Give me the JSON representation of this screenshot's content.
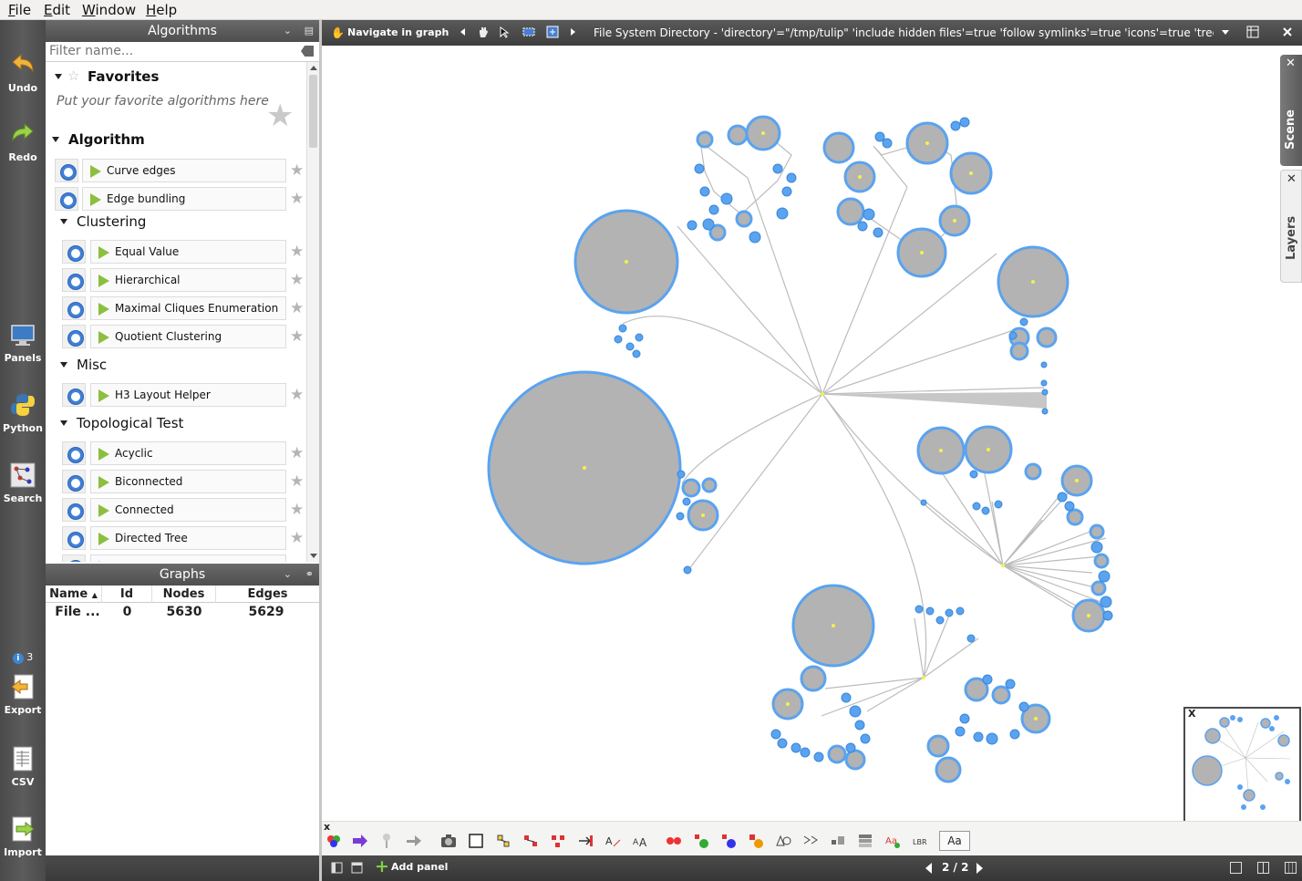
{
  "menu": {
    "file": "File",
    "edit": "Edit",
    "window": "Window",
    "help": "Help"
  },
  "leftbar": {
    "undo": "Undo",
    "redo": "Redo",
    "panels": "Panels",
    "python": "Python",
    "search": "Search",
    "info_count": "3",
    "export": "Export",
    "csv": "CSV",
    "import": "Import"
  },
  "algorithms_panel": {
    "title": "Algorithms",
    "filter_placeholder": "Filter name...",
    "favorites_label": "Favorites",
    "favorites_hint": "Put your favorite algorithms here",
    "algorithm_label": "Algorithm",
    "top_items": [
      "Curve edges",
      "Edge bundling"
    ],
    "clustering_label": "Clustering",
    "clustering_items": [
      "Equal Value",
      "Hierarchical",
      "Maximal Cliques Enumeration",
      "Quotient Clustering"
    ],
    "misc_label": "Misc",
    "misc_items": [
      "H3 Layout Helper"
    ],
    "topological_label": "Topological Test",
    "topological_items": [
      "Acyclic",
      "Biconnected",
      "Connected",
      "Directed Tree"
    ]
  },
  "graphs_panel": {
    "title": "Graphs",
    "columns": [
      "Name",
      "Id",
      "Nodes",
      "Edges"
    ],
    "row": {
      "name": "File ...",
      "id": "0",
      "nodes": "5630",
      "edges": "5629"
    }
  },
  "view": {
    "navigate_label": "Navigate in graph",
    "title": "File System Directory - 'directory'=\"/tmp/tulip\" 'include hidden files'=true 'follow symlinks'=true 'icons'=true 'tree layout'=tru",
    "scene_tab": "Scene",
    "layers_tab": "Layers",
    "font_button": "Aa",
    "add_panel": "Add panel",
    "page_indicator": "2 / 2"
  },
  "colors": {
    "node_fill": "#b3b3b3",
    "node_border": "#5aa3f0",
    "edge": "#b8b8b8",
    "center_dot": "#f2f24a"
  }
}
